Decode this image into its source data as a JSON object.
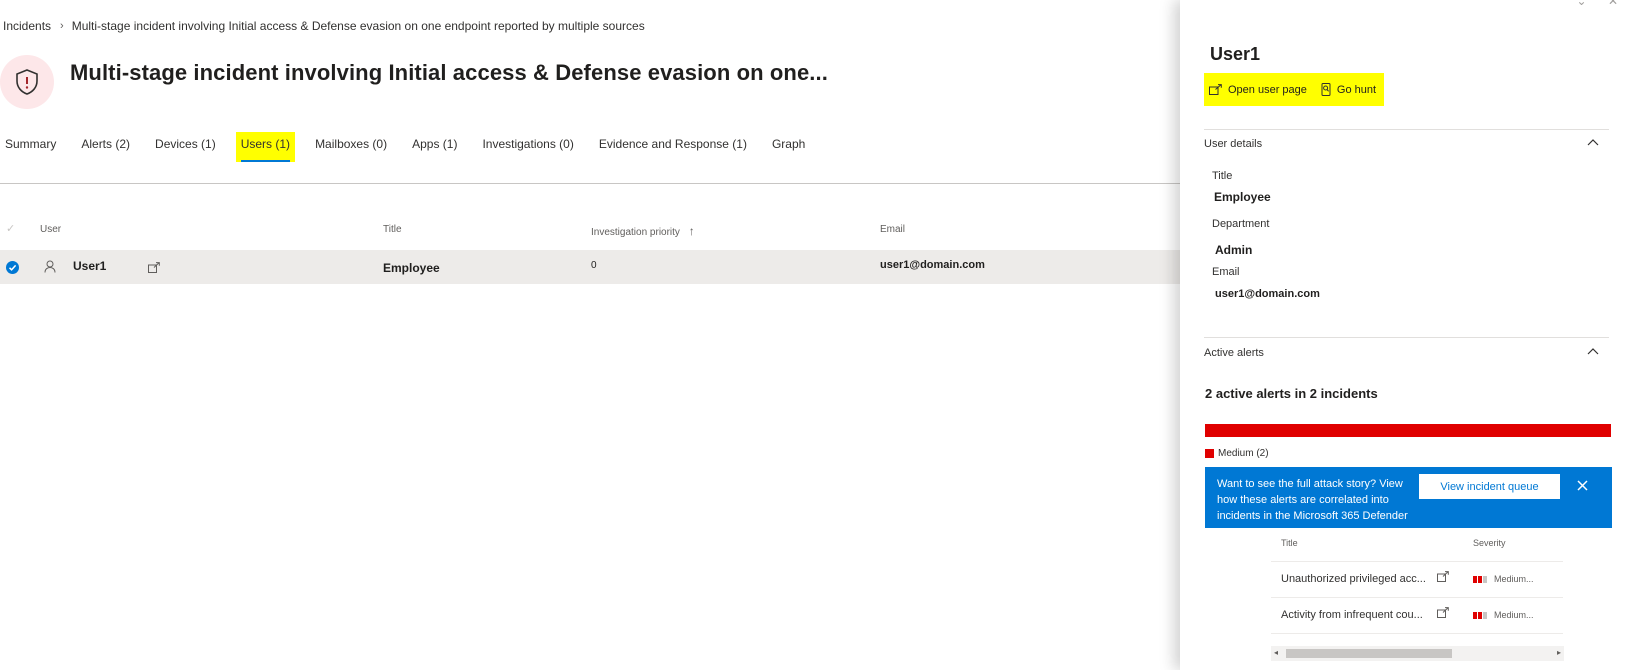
{
  "breadcrumb": {
    "root": "Incidents",
    "current": "Multi-stage incident involving Initial access & Defense evasion on one endpoint reported by multiple sources"
  },
  "page_title": "Multi-stage incident involving Initial access & Defense evasion on one...",
  "tabs": [
    {
      "label": "Summary"
    },
    {
      "label": "Alerts (2)"
    },
    {
      "label": "Devices (1)"
    },
    {
      "label": "Users (1)"
    },
    {
      "label": "Mailboxes (0)"
    },
    {
      "label": "Apps (1)"
    },
    {
      "label": "Investigations (0)"
    },
    {
      "label": "Evidence and Response (1)"
    },
    {
      "label": "Graph"
    }
  ],
  "active_tab": "Users (1)",
  "grid": {
    "columns": {
      "user": "User",
      "title": "Title",
      "priority": "Investigation priority",
      "email": "Email"
    },
    "rows": [
      {
        "user": "User1",
        "title": "Employee",
        "priority": "0",
        "email": "user1@domain.com"
      }
    ]
  },
  "panel": {
    "title": "User1",
    "actions": {
      "open_user_page": "Open user page",
      "go_hunt": "Go hunt"
    },
    "user_details": {
      "heading": "User details",
      "title_label": "Title",
      "title_value": "Employee",
      "department_label": "Department",
      "department_value": "Admin",
      "email_label": "Email",
      "email_value": "user1@domain.com"
    },
    "active_alerts": {
      "heading": "Active alerts",
      "summary": "2 active alerts in 2 incidents",
      "legend": "Medium (2)",
      "severity_color": "#e00000",
      "banner_text": "Want to see the full attack story? View how these alerts are correlated into incidents in the Microsoft 365 Defender",
      "banner_button": "View incident queue",
      "table": {
        "col_title": "Title",
        "col_severity": "Severity",
        "rows": [
          {
            "title": "Unauthorized privileged acc...",
            "severity": "Medium..."
          },
          {
            "title": "Activity from infrequent cou...",
            "severity": "Medium..."
          }
        ]
      }
    }
  },
  "colors": {
    "accent": "#0078d4",
    "highlight": "#ffff00",
    "danger": "#e00000"
  }
}
